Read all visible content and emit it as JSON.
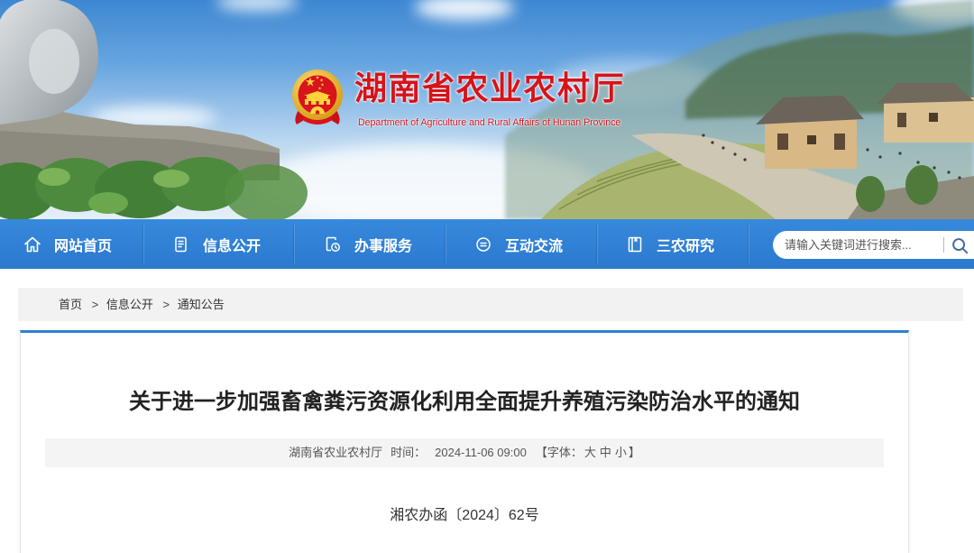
{
  "header": {
    "title": "湖南省农业农村厅",
    "subtitle": "Department of Agriculture and Rural Affairs of Hunan Province",
    "logo_icon": "national-emblem-icon"
  },
  "nav": {
    "items": [
      {
        "label": "网站首页",
        "icon": "home-icon"
      },
      {
        "label": "信息公开",
        "icon": "document-icon"
      },
      {
        "label": "办事服务",
        "icon": "service-icon"
      },
      {
        "label": "互动交流",
        "icon": "chat-icon"
      },
      {
        "label": "三农研究",
        "icon": "book-icon"
      }
    ],
    "search_placeholder": "请输入关键词进行搜索...",
    "search_icon": "search-icon"
  },
  "breadcrumb": {
    "items": [
      "首页",
      "信息公开",
      "通知公告"
    ],
    "separator": ">"
  },
  "article": {
    "title": "关于进一步加强畜禽粪污资源化利用全面提升养殖污染防治水平的通知",
    "source": "湖南省农业农村厅",
    "time_label": "时间：",
    "time": "2024-11-06 09:00",
    "font_size_label": "【字体：",
    "font_sizes": [
      "大",
      "中",
      "小"
    ],
    "font_size_close": "】",
    "doc_number": "湘农办函〔2024〕62号"
  },
  "colors": {
    "brand_red": "#d6131a",
    "nav_blue": "#2d7fd5",
    "breadcrumb_bg": "#f2f2f2",
    "meta_bg": "#f4f4f4",
    "title_text": "#222222"
  }
}
